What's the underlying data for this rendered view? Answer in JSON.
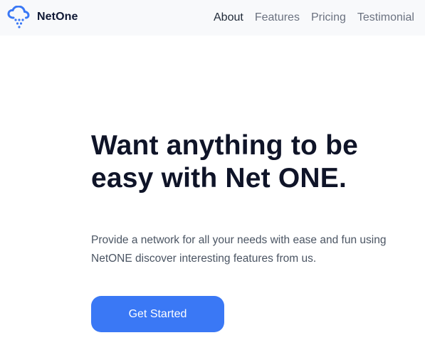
{
  "brand": {
    "name": "NetOne",
    "logo_icon": "cloud-rain-icon",
    "logo_color": "#3a78f5"
  },
  "nav": {
    "items": [
      {
        "label": "About"
      },
      {
        "label": "Features"
      },
      {
        "label": "Pricing"
      },
      {
        "label": "Testimonial"
      }
    ]
  },
  "hero": {
    "title_prefix": "Want anything to be easy with Net ",
    "title_emphasis": "ONE",
    "title_suffix": ".",
    "description": "Provide a network for all your needs with ease and fun using NetONE discover interesting features from us.",
    "cta_label": "Get Started",
    "cta_color": "#3a78f5"
  }
}
